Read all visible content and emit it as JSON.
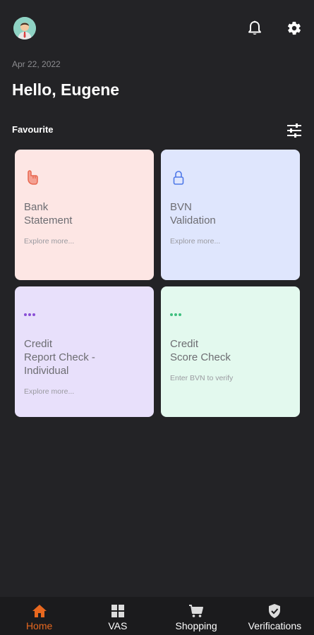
{
  "header": {
    "avatar_icon": "user-avatar-icon",
    "notification_icon": "bell-icon",
    "settings_icon": "gear-icon"
  },
  "date": "Apr 22, 2022",
  "greeting": "Hello, Eugene",
  "favourites": {
    "title": "Favourite",
    "filter_icon": "sliders-icon",
    "cards": [
      {
        "title": "Bank\nStatement",
        "subtitle": "Explore more...",
        "icon": "hand-icon",
        "background": "#fde6e4",
        "accent": "#e8674f"
      },
      {
        "title": "BVN\nValidation",
        "subtitle": "Explore more...",
        "icon": "lock-icon",
        "background": "#dfe6fd",
        "accent": "#4f79e8"
      },
      {
        "title": "Credit\nReport Check -\nIndividual",
        "subtitle": "Explore more...",
        "icon": "more-dots-icon",
        "background": "#e8e0fb",
        "accent": "#8a4fd6"
      },
      {
        "title": "Credit\nScore Check",
        "subtitle": "Enter BVN to verify",
        "icon": "more-dots-icon",
        "background": "#e3f9ee",
        "accent": "#3fbf7f"
      }
    ]
  },
  "bottom_nav": {
    "items": [
      {
        "label": "Home",
        "icon": "home-icon",
        "active": true
      },
      {
        "label": "VAS",
        "icon": "grid-icon",
        "active": false
      },
      {
        "label": "Shopping",
        "icon": "cart-icon",
        "active": false
      },
      {
        "label": "Verifications",
        "icon": "shield-check-icon",
        "active": false
      }
    ],
    "active_color": "#e8681f"
  }
}
